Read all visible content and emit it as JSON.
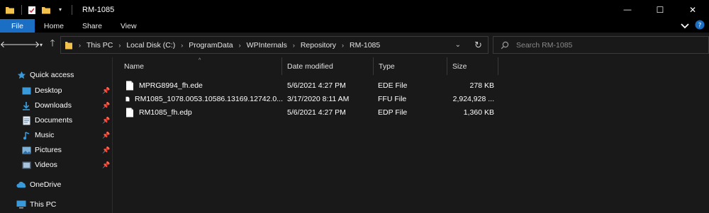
{
  "window": {
    "title": "RM-1085",
    "controls": {
      "minimize": "—",
      "maximize": "☐",
      "close": "✕"
    }
  },
  "ribbon": {
    "tabs": [
      "File",
      "Home",
      "Share",
      "View"
    ]
  },
  "address": {
    "breadcrumbs": [
      "This PC",
      "Local Disk (C:)",
      "ProgramData",
      "WPInternals",
      "Repository",
      "RM-1085"
    ],
    "search_placeholder": "Search RM-1085"
  },
  "nav_pane": {
    "quick_access": "Quick access",
    "pinned": [
      {
        "label": "Desktop",
        "icon": "desktop-icon"
      },
      {
        "label": "Downloads",
        "icon": "downloads-icon"
      },
      {
        "label": "Documents",
        "icon": "documents-icon"
      },
      {
        "label": "Music",
        "icon": "music-icon"
      },
      {
        "label": "Pictures",
        "icon": "pictures-icon"
      },
      {
        "label": "Videos",
        "icon": "videos-icon"
      }
    ],
    "onedrive": "OneDrive",
    "this_pc": "This PC"
  },
  "file_list": {
    "columns": [
      "Name",
      "Date modified",
      "Type",
      "Size"
    ],
    "rows": [
      {
        "name": "MPRG8994_fh.ede",
        "date": "5/6/2021 4:27 PM",
        "type": "EDE File",
        "size": "278 KB"
      },
      {
        "name": "RM1085_1078.0053.10586.13169.12742.0...",
        "date": "3/17/2020 8:11 AM",
        "type": "FFU File",
        "size": "2,924,928 ..."
      },
      {
        "name": "RM1085_fh.edp",
        "date": "5/6/2021 4:27 PM",
        "type": "EDP File",
        "size": "1,360 KB"
      }
    ]
  },
  "colors": {
    "background": "#191919",
    "titlebar": "#000000",
    "file_tab": "#1a6fc4",
    "folder_yellow": "#f2c14e",
    "accent_blue": "#3a9ad9"
  }
}
